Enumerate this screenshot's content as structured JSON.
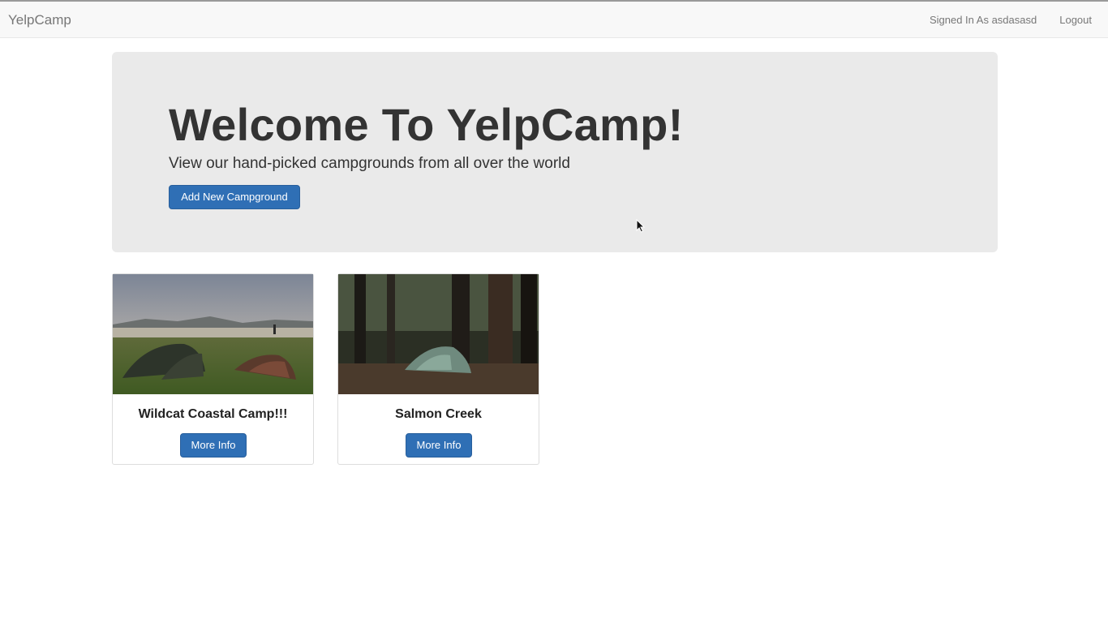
{
  "navbar": {
    "brand": "YelpCamp",
    "signed_in": "Signed In As asdasasd",
    "logout": "Logout"
  },
  "jumbotron": {
    "title": "Welcome To YelpCamp!",
    "subtitle": "View our hand-picked campgrounds from all over the world",
    "add_button": "Add New Campground"
  },
  "campgrounds": [
    {
      "name": "Wildcat Coastal Camp!!!",
      "button": "More Info",
      "image": "tents-on-grass-by-lake-photo"
    },
    {
      "name": "Salmon Creek",
      "button": "More Info",
      "image": "tent-in-forest-photo"
    }
  ],
  "colors": {
    "primary_button": "#2f6fb5",
    "jumbotron_bg": "#eaeaea",
    "navbar_bg": "#f8f8f8"
  }
}
